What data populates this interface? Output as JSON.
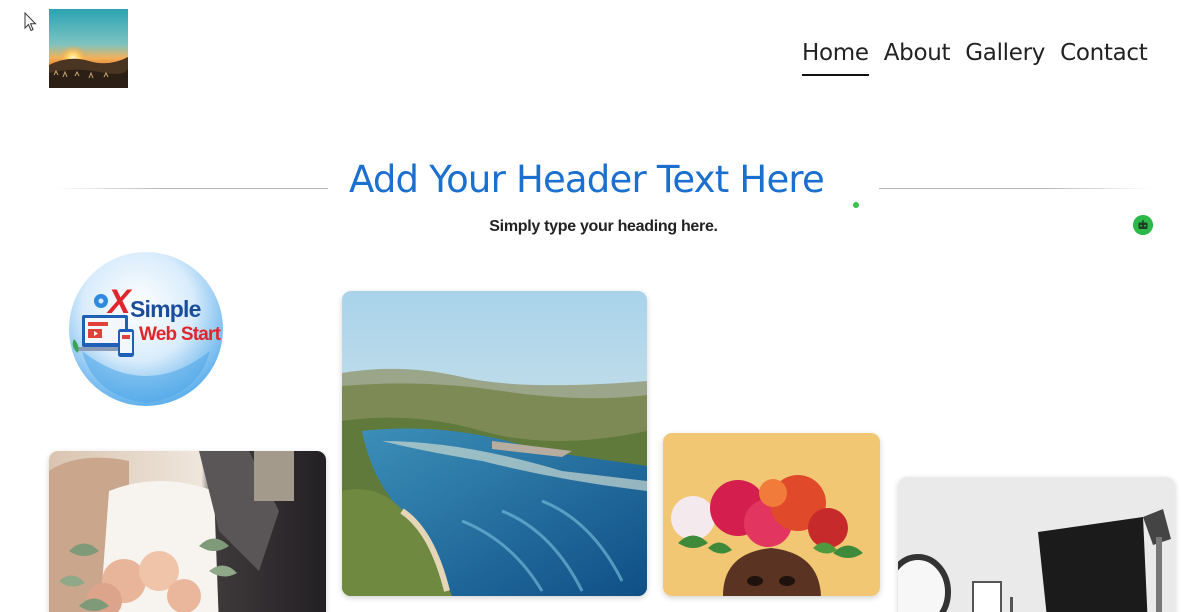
{
  "nav": {
    "items": [
      {
        "label": "Home",
        "active": true
      },
      {
        "label": "About",
        "active": false
      },
      {
        "label": "Gallery",
        "active": false
      },
      {
        "label": "Contact",
        "active": false
      }
    ]
  },
  "section": {
    "title": "Add Your Header Text Here",
    "subtitle": "Simply type your heading here."
  },
  "brand_logo": {
    "line1": "Simple",
    "line2": "Web Start",
    "letter": "X"
  },
  "colors": {
    "heading_blue": "#1a6fcf",
    "status_green": "#37c24a",
    "nav_text": "#222222"
  },
  "icons": {
    "cursor": "mouse-pointer-icon",
    "bot": "robot-icon"
  },
  "gallery": [
    {
      "name": "wedding-photo"
    },
    {
      "name": "coastal-aerial-photo"
    },
    {
      "name": "flower-crown-photo"
    },
    {
      "name": "photo-studio-photo"
    }
  ]
}
